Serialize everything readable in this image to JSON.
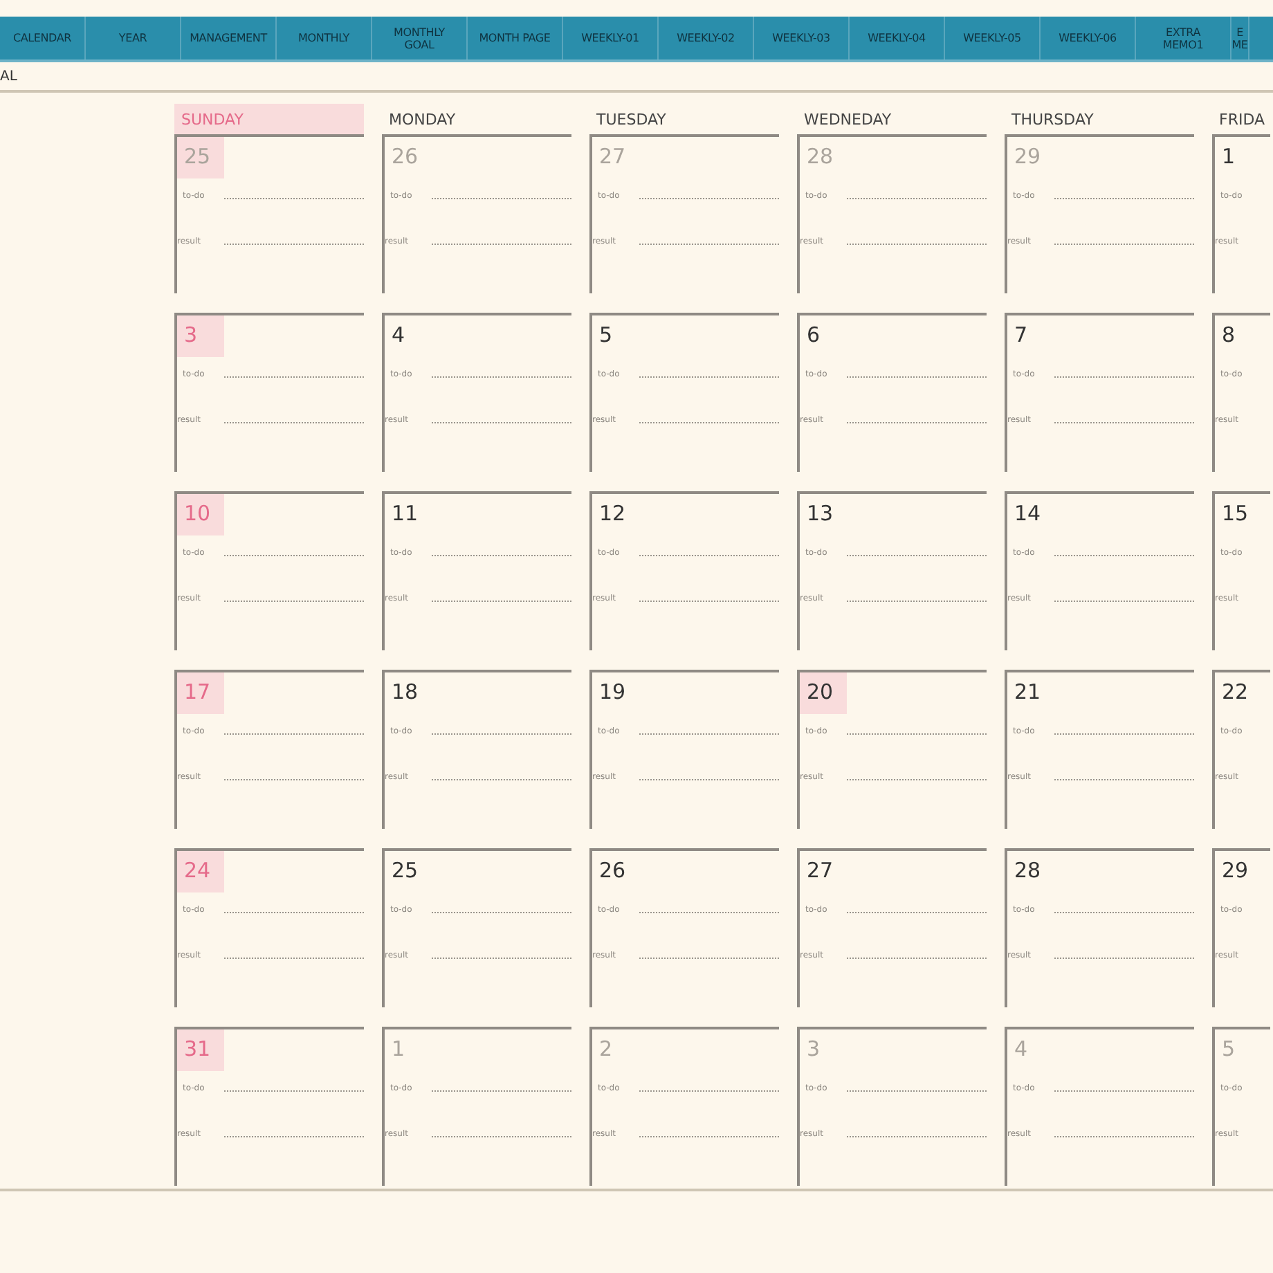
{
  "tabs": [
    {
      "label": "CALENDAR"
    },
    {
      "label": "YEAR"
    },
    {
      "label": "MANAGEMENT"
    },
    {
      "label": "MONTHLY"
    },
    {
      "label": "MONTHLY\nGOAL"
    },
    {
      "label": "MONTH PAGE"
    },
    {
      "label": "WEEKLY-01"
    },
    {
      "label": "WEEKLY-02"
    },
    {
      "label": "WEEKLY-03"
    },
    {
      "label": "WEEKLY-04"
    },
    {
      "label": "WEEKLY-05"
    },
    {
      "label": "WEEKLY-06"
    },
    {
      "label": "EXTRA\nMEMO1"
    },
    {
      "label": "E\nME"
    }
  ],
  "section_label": "AL",
  "weekdays": [
    {
      "label": "SUNDAY",
      "holiday": true
    },
    {
      "label": "MONDAY",
      "holiday": false
    },
    {
      "label": "TUESDAY",
      "holiday": false
    },
    {
      "label": "WEDNEDAY",
      "holiday": false
    },
    {
      "label": "THURSDAY",
      "holiday": false
    },
    {
      "label": "FRIDA",
      "holiday": false
    }
  ],
  "weeks": [
    [
      {
        "day": "25",
        "kind": "muted",
        "highlighted": true,
        "todo": "to-do",
        "result": "result"
      },
      {
        "day": "26",
        "kind": "muted",
        "highlighted": false,
        "todo": "to-do",
        "result": "result"
      },
      {
        "day": "27",
        "kind": "muted",
        "highlighted": false,
        "todo": "to-do",
        "result": "result"
      },
      {
        "day": "28",
        "kind": "muted",
        "highlighted": false,
        "todo": "to-do",
        "result": "result"
      },
      {
        "day": "29",
        "kind": "muted",
        "highlighted": false,
        "todo": "to-do",
        "result": "result"
      },
      {
        "day": "1",
        "kind": "normal",
        "highlighted": false,
        "todo": "to-do",
        "result": "result"
      }
    ],
    [
      {
        "day": "3",
        "kind": "holiday",
        "highlighted": true,
        "todo": "to-do",
        "result": "result"
      },
      {
        "day": "4",
        "kind": "normal",
        "highlighted": false,
        "todo": "to-do",
        "result": "result"
      },
      {
        "day": "5",
        "kind": "normal",
        "highlighted": false,
        "todo": "to-do",
        "result": "result"
      },
      {
        "day": "6",
        "kind": "normal",
        "highlighted": false,
        "todo": "to-do",
        "result": "result"
      },
      {
        "day": "7",
        "kind": "normal",
        "highlighted": false,
        "todo": "to-do",
        "result": "result"
      },
      {
        "day": "8",
        "kind": "normal",
        "highlighted": false,
        "todo": "to-do",
        "result": "result"
      }
    ],
    [
      {
        "day": "10",
        "kind": "holiday",
        "highlighted": true,
        "todo": "to-do",
        "result": "result"
      },
      {
        "day": "11",
        "kind": "normal",
        "highlighted": false,
        "todo": "to-do",
        "result": "result"
      },
      {
        "day": "12",
        "kind": "normal",
        "highlighted": false,
        "todo": "to-do",
        "result": "result"
      },
      {
        "day": "13",
        "kind": "normal",
        "highlighted": false,
        "todo": "to-do",
        "result": "result"
      },
      {
        "day": "14",
        "kind": "normal",
        "highlighted": false,
        "todo": "to-do",
        "result": "result"
      },
      {
        "day": "15",
        "kind": "normal",
        "highlighted": false,
        "todo": "to-do",
        "result": "result"
      }
    ],
    [
      {
        "day": "17",
        "kind": "holiday",
        "highlighted": true,
        "todo": "to-do",
        "result": "result"
      },
      {
        "day": "18",
        "kind": "normal",
        "highlighted": false,
        "todo": "to-do",
        "result": "result"
      },
      {
        "day": "19",
        "kind": "normal",
        "highlighted": false,
        "todo": "to-do",
        "result": "result"
      },
      {
        "day": "20",
        "kind": "normal",
        "highlighted": true,
        "todo": "to-do",
        "result": "result"
      },
      {
        "day": "21",
        "kind": "normal",
        "highlighted": false,
        "todo": "to-do",
        "result": "result"
      },
      {
        "day": "22",
        "kind": "normal",
        "highlighted": false,
        "todo": "to-do",
        "result": "result"
      }
    ],
    [
      {
        "day": "24",
        "kind": "holiday",
        "highlighted": true,
        "todo": "to-do",
        "result": "result"
      },
      {
        "day": "25",
        "kind": "normal",
        "highlighted": false,
        "todo": "to-do",
        "result": "result"
      },
      {
        "day": "26",
        "kind": "normal",
        "highlighted": false,
        "todo": "to-do",
        "result": "result"
      },
      {
        "day": "27",
        "kind": "normal",
        "highlighted": false,
        "todo": "to-do",
        "result": "result"
      },
      {
        "day": "28",
        "kind": "normal",
        "highlighted": false,
        "todo": "to-do",
        "result": "result"
      },
      {
        "day": "29",
        "kind": "normal",
        "highlighted": false,
        "todo": "to-do",
        "result": "result"
      }
    ],
    [
      {
        "day": "31",
        "kind": "holiday",
        "highlighted": true,
        "todo": "to-do",
        "result": "result"
      },
      {
        "day": "1",
        "kind": "muted",
        "highlighted": false,
        "todo": "to-do",
        "result": "result"
      },
      {
        "day": "2",
        "kind": "muted",
        "highlighted": false,
        "todo": "to-do",
        "result": "result"
      },
      {
        "day": "3",
        "kind": "muted",
        "highlighted": false,
        "todo": "to-do",
        "result": "result"
      },
      {
        "day": "4",
        "kind": "muted",
        "highlighted": false,
        "todo": "to-do",
        "result": "result"
      },
      {
        "day": "5",
        "kind": "muted",
        "highlighted": false,
        "todo": "to-do",
        "result": "result"
      }
    ]
  ]
}
